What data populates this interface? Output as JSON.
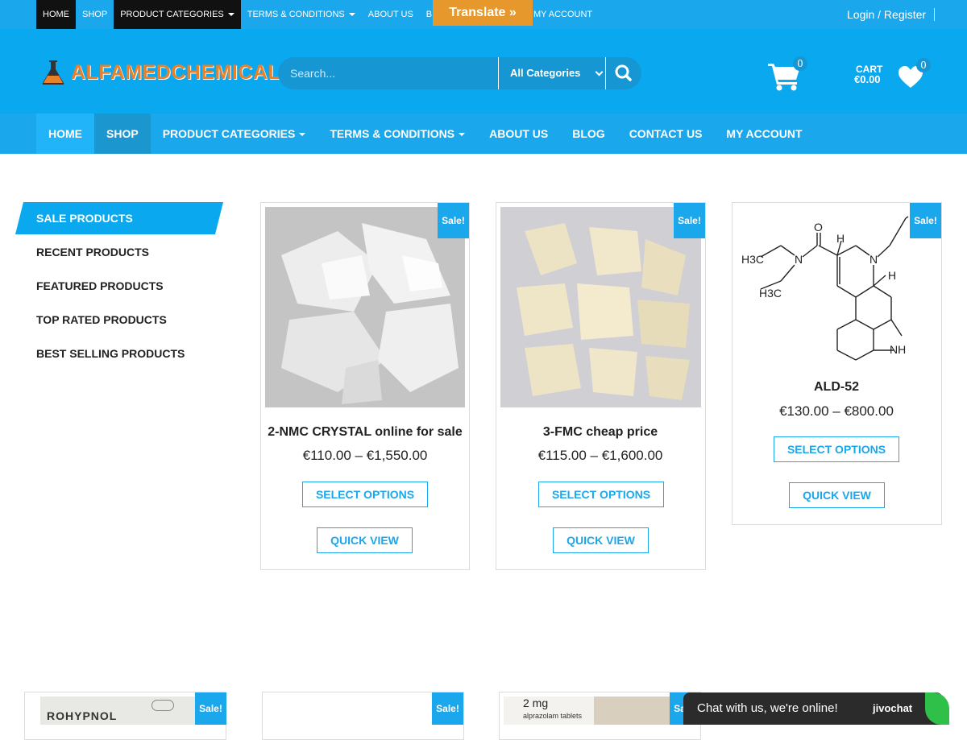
{
  "top_nav": {
    "items": [
      {
        "label": "HOME",
        "dark": true
      },
      {
        "label": "SHOP",
        "dark": false
      },
      {
        "label": "PRODUCT CATEGORIES",
        "dark": true,
        "caret": true
      },
      {
        "label": "TERMS & CONDITIONS",
        "dark": false,
        "caret": true
      },
      {
        "label": "ABOUT US",
        "dark": false
      },
      {
        "label": "B",
        "dark": false
      }
    ],
    "my_account": "MY ACCOUNT",
    "translate": "Translate »",
    "login": "Login / Register"
  },
  "header": {
    "logo_text": "ALFAMEDCHEMICAL",
    "search_placeholder": "Search...",
    "category_select": "All Categories",
    "cart_count": "0",
    "cart_label": "CART",
    "cart_total": "€0.00",
    "wishlist_count": "0"
  },
  "main_nav": {
    "items": [
      "HOME",
      "SHOP",
      "PRODUCT CATEGORIES",
      "TERMS & CONDITIONS",
      "ABOUT US",
      "BLOG",
      "CONTACT US",
      "MY ACCOUNT"
    ]
  },
  "sidebar": {
    "active": "SALE PRODUCTS",
    "links": [
      "RECENT PRODUCTS",
      "FEATURED PRODUCTS",
      "TOP RATED PRODUCTS",
      "BEST SELLING PRODUCTS"
    ]
  },
  "sale_badge": "Sale!",
  "products": [
    {
      "title": "2-NMC CRYSTAL online for sale",
      "price": "€110.00 – €1,550.00",
      "select_label": "SELECT OPTIONS",
      "quick_label": "QUICK VIEW"
    },
    {
      "title": "3-FMC cheap price",
      "price": "€115.00 – €1,600.00",
      "select_label": "SELECT OPTIONS",
      "quick_label": "QUICK VIEW"
    },
    {
      "title": "ALD-52",
      "price": "€130.00 – €800.00",
      "select_label": "SELECT OPTIONS",
      "quick_label": "QUICK VIEW"
    }
  ],
  "bottom_products": [
    {
      "image_text": "ROHYPNOL"
    },
    {
      "image_text": ""
    },
    {
      "image_text": "2 mg",
      "image_subtext": "alprazolam tablets"
    }
  ],
  "structure_labels": {
    "h3c_top": "H3C",
    "h3c_bottom": "H3C",
    "n1": "N",
    "n2": "N",
    "o": "O",
    "h1": "H",
    "h2": "H",
    "nh": "NH"
  },
  "chat": {
    "text": "Chat with us, we're online!",
    "brand": "jivochat"
  }
}
